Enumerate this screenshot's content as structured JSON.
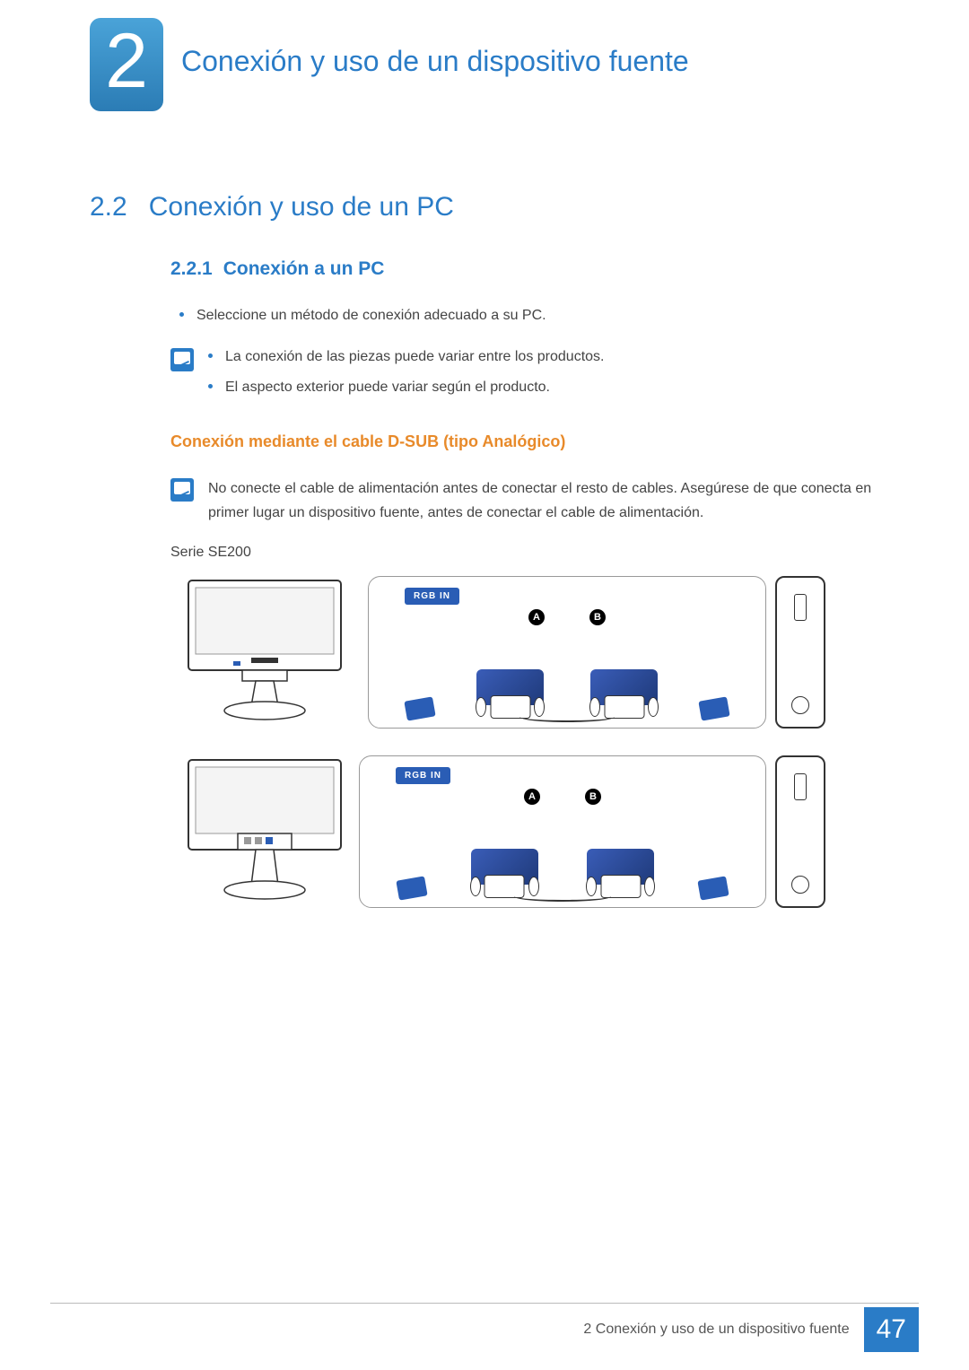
{
  "chapter": {
    "number": "2",
    "title": "Conexión y uso de un dispositivo fuente"
  },
  "section": {
    "number": "2.2",
    "title": "Conexión y uso de un PC"
  },
  "subsection": {
    "number": "2.2.1",
    "title": "Conexión a un PC"
  },
  "bullet1": "Seleccione un método de conexión adecuado a su PC.",
  "note1": {
    "items": [
      "La conexión de las piezas puede variar entre los productos.",
      "El aspecto exterior puede variar según el producto."
    ]
  },
  "subheading_dsub": "Conexión mediante el cable D-SUB (tipo Analógico)",
  "note2": "No conecte el cable de alimentación antes de conectar el resto de cables. Asegúrese de que conecta en primer lugar un dispositivo fuente, antes de conectar el cable de alimentación.",
  "series_label": "Serie SE200",
  "diagram": {
    "port_label": "RGB IN",
    "labelA": "A",
    "labelB": "B"
  },
  "footer": {
    "chapter_ref": "2 Conexión y uso de un dispositivo fuente",
    "page_number": "47"
  }
}
